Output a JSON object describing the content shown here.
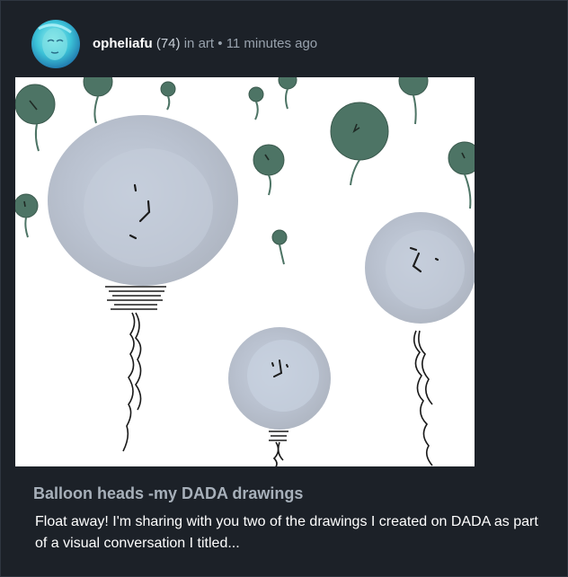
{
  "post": {
    "author": "opheliafu",
    "reputation": "(74)",
    "in_label": "in",
    "community": "art",
    "separator": "•",
    "time": "11 minutes ago",
    "title": "Balloon heads -my DADA drawings",
    "summary": "Float away! I'm sharing with you two of the drawings I created on DADA as part of a visual conversation I titled..."
  },
  "colors": {
    "background": "#1c2128",
    "title": "#a7b0ba",
    "body_text": "#ffffff",
    "muted": "#98a2ad",
    "balloon_big": "#b8bfcb",
    "balloon_dark": "#4d7465"
  }
}
